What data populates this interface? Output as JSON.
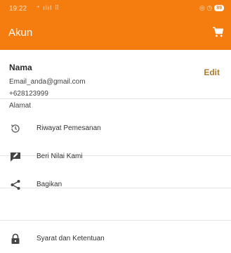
{
  "status_bar": {
    "time": "19:22",
    "signal": "⁺ ılıl ⠿",
    "icons": "◎ ◷",
    "battery": "89"
  },
  "header": {
    "title": "Akun",
    "cart_icon": "cart-icon",
    "bg_color": "#f57c0f"
  },
  "profile": {
    "name": "Nama",
    "email": "Email_anda@gmail.com",
    "phone": "+628123999",
    "address": "Alamat",
    "edit_label": "Edit"
  },
  "menu": [
    {
      "label": "Riwayat Pemesanan",
      "icon": "history-icon"
    },
    {
      "label": "Beri Nilai Kami",
      "icon": "rate-icon"
    },
    {
      "label": "Bagikan",
      "icon": "share-icon"
    },
    {
      "label": "Syarat dan Ketentuan",
      "icon": "lock-icon"
    }
  ]
}
